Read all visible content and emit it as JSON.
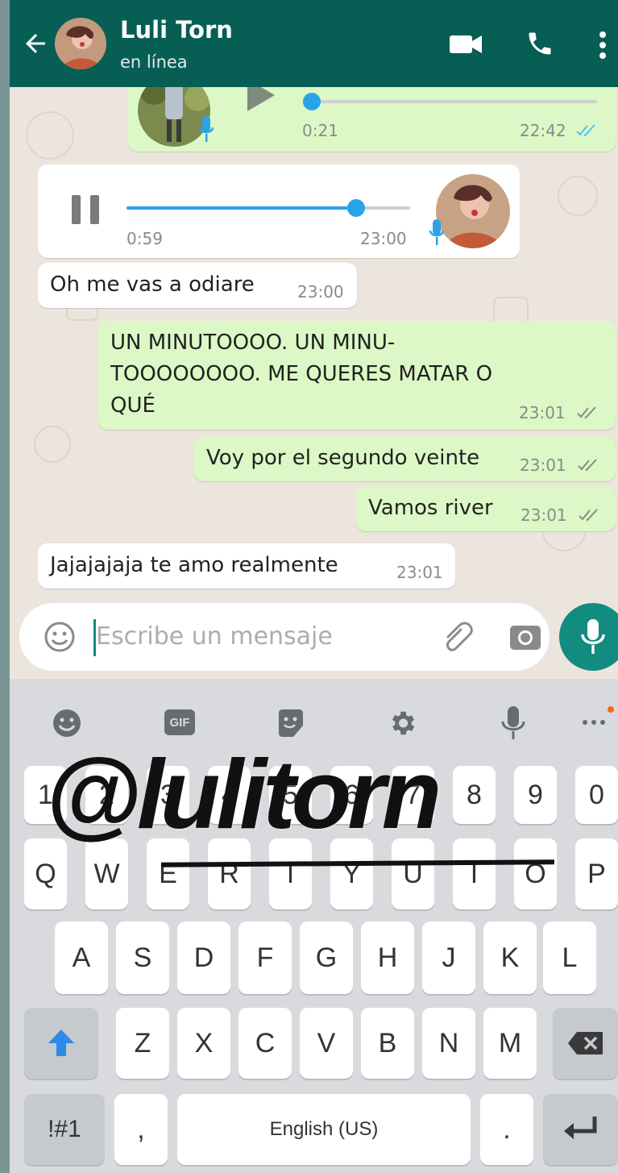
{
  "colors": {
    "header": "#075e54",
    "accent": "#128c7e",
    "outgoing": "#dcf8c6",
    "incoming": "#ffffff",
    "audio_progress": "#2ba3e8",
    "read_ticks": "#4fc3f7"
  },
  "header": {
    "contact_name": "Luli Torn",
    "status": "en línea",
    "icons": [
      "back-arrow-icon",
      "video-call-icon",
      "phone-icon",
      "more-vert-icon"
    ]
  },
  "messages": {
    "voice_out": {
      "duration": "0:21",
      "time": "22:42",
      "progress": 0.0
    },
    "voice_in": {
      "elapsed": "0:59",
      "time": "23:00",
      "progress": 0.81
    },
    "m1": {
      "text": "Oh me vas a odiare",
      "time": "23:00"
    },
    "m2": {
      "line1": "UN MINUTOOOO. UN MINU-",
      "line2": "TOOOOOOOO. ME QUERES MATAR O",
      "line3": "QUÉ",
      "time": "23:01"
    },
    "m3": {
      "text": "Voy por el segundo veinte",
      "time": "23:01"
    },
    "m4": {
      "text": "Vamos river",
      "time": "23:01"
    },
    "m5": {
      "text": "Jajajajaja te amo realmente",
      "time": "23:01"
    }
  },
  "input": {
    "placeholder": "Escribe un mensaje"
  },
  "keyboard": {
    "toolbar": {
      "gif_label": "GIF"
    },
    "number_row": [
      "1",
      "2",
      "3",
      "4",
      "5",
      "6",
      "7",
      "8",
      "9",
      "0"
    ],
    "row1": [
      "Q",
      "W",
      "E",
      "R",
      "T",
      "Y",
      "U",
      "I",
      "O",
      "P"
    ],
    "row2": [
      "A",
      "S",
      "D",
      "F",
      "G",
      "H",
      "J",
      "K",
      "L"
    ],
    "row3": [
      "Z",
      "X",
      "C",
      "V",
      "B",
      "N",
      "M"
    ],
    "symbols_label": "!#1",
    "comma_label": ",",
    "space_label": "English (US)",
    "period_label": "."
  },
  "overlay": {
    "sticker_text": "@lulitorn"
  }
}
